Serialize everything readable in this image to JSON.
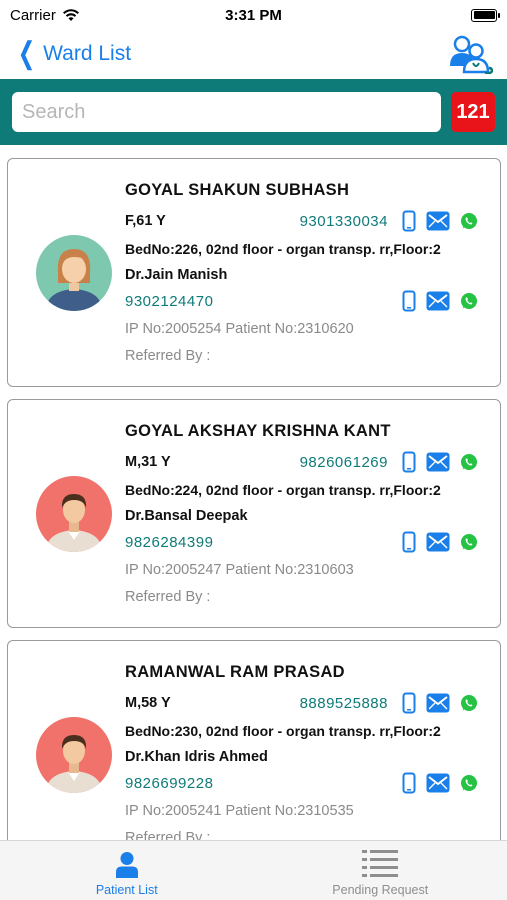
{
  "status_bar": {
    "carrier": "Carrier",
    "time": "3:31 PM"
  },
  "nav": {
    "back_label": "Ward List",
    "right_icon": "doctors-icon"
  },
  "search": {
    "placeholder": "Search",
    "value": "",
    "count": "121"
  },
  "patients": [
    {
      "name": "GOYAL SHAKUN SUBHASH",
      "gender_age": "F,61 Y",
      "phone": "9301330034",
      "bed": "BedNo:226, 02nd floor - organ transp. rr,Floor:2",
      "doctor": "Dr.Jain Manish",
      "doctor_phone": "9302124470",
      "ids": "IP No:2005254 Patient No:2310620",
      "referred": "Referred By :",
      "avatar": "female"
    },
    {
      "name": "GOYAL AKSHAY KRISHNA KANT",
      "gender_age": "M,31 Y",
      "phone": "9826061269",
      "bed": "BedNo:224, 02nd floor - organ transp. rr,Floor:2",
      "doctor": "Dr.Bansal Deepak",
      "doctor_phone": "9826284399",
      "ids": "IP No:2005247 Patient No:2310603",
      "referred": "Referred By :",
      "avatar": "male"
    },
    {
      "name": "RAMANWAL RAM PRASAD",
      "gender_age": "M,58 Y",
      "phone": "8889525888",
      "bed": "BedNo:230, 02nd floor - organ transp. rr,Floor:2",
      "doctor": "Dr.Khan Idris Ahmed",
      "doctor_phone": "9826699228",
      "ids": "IP No:2005241 Patient No:2310535",
      "referred": "Referred By :",
      "avatar": "male"
    }
  ],
  "tabs": [
    {
      "label": "Patient List",
      "icon": "person-icon",
      "active": true
    },
    {
      "label": "Pending Request",
      "icon": "list-icon",
      "active": false
    }
  ],
  "colors": {
    "accent": "#1a7fe8",
    "teal": "#0f7b78",
    "badge": "#e8141a",
    "whatsapp": "#25c243"
  }
}
